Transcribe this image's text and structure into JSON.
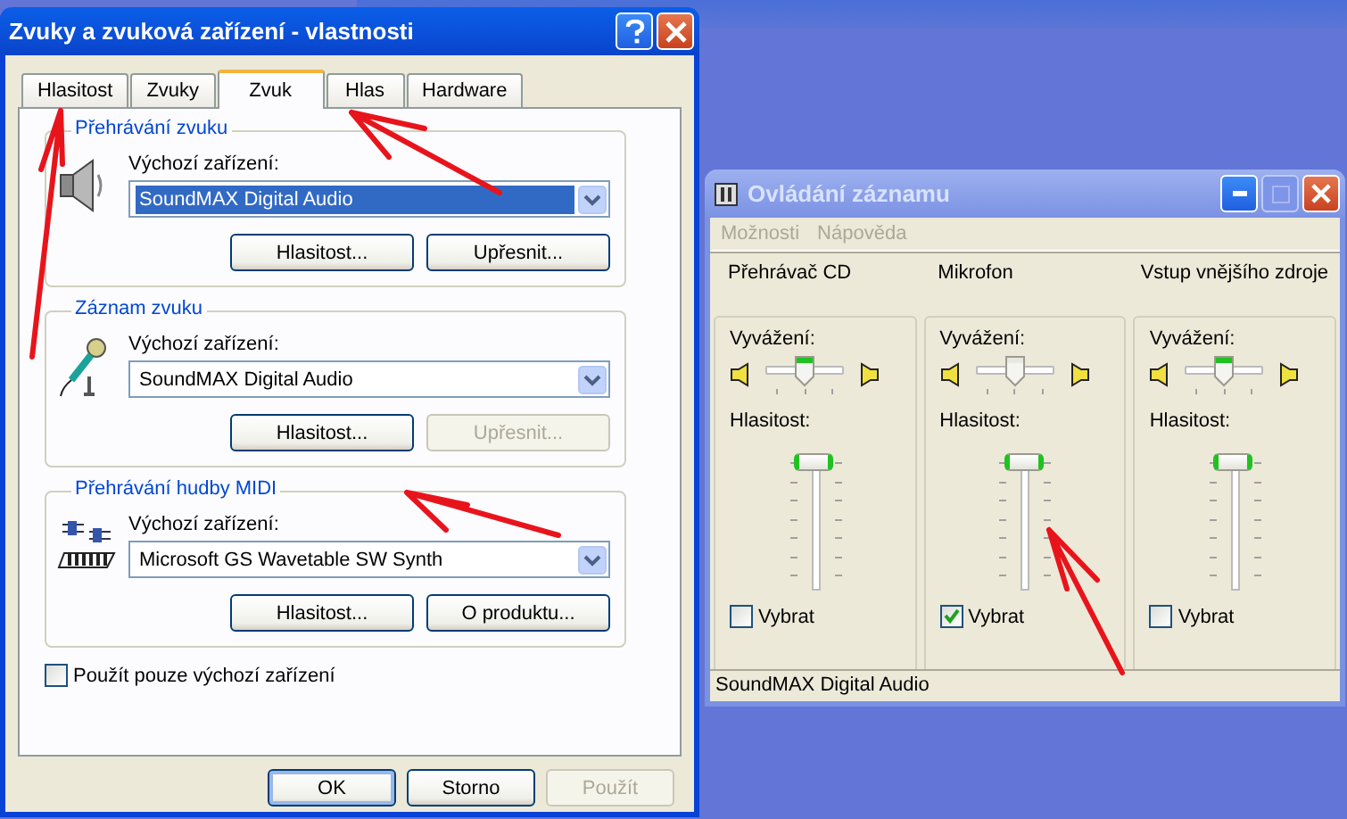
{
  "dialog": {
    "title": "Zvuky a zvuková zařízení - vlastnosti",
    "tabs": [
      {
        "label": "Hlasitost",
        "selected": false
      },
      {
        "label": "Zvuky",
        "selected": false
      },
      {
        "label": "Zvuk",
        "selected": true
      },
      {
        "label": "Hlas",
        "selected": false
      },
      {
        "label": "Hardware",
        "selected": false
      }
    ],
    "groups": [
      {
        "kind": "speaker",
        "legend": "Přehrávání zvuku",
        "field_label": "Výchozí zařízení:",
        "device": "SoundMAX Digital Audio",
        "focused": true,
        "buttons": [
          {
            "label": "Hlasitost...",
            "disabled": false
          },
          {
            "label": "Upřesnit...",
            "disabled": false
          }
        ]
      },
      {
        "kind": "microphone",
        "legend": "Záznam zvuku",
        "field_label": "Výchozí zařízení:",
        "device": "SoundMAX Digital Audio",
        "focused": false,
        "buttons": [
          {
            "label": "Hlasitost...",
            "disabled": false
          },
          {
            "label": "Upřesnit...",
            "disabled": true
          }
        ]
      },
      {
        "kind": "midi",
        "legend": "Přehrávání hudby MIDI",
        "field_label": "Výchozí zařízení:",
        "device": "Microsoft GS Wavetable SW Synth",
        "focused": false,
        "buttons": [
          {
            "label": "Hlasitost...",
            "disabled": false
          },
          {
            "label": "O produktu...",
            "disabled": false
          }
        ]
      }
    ],
    "checkbox": {
      "label": "Použít pouze výchozí zařízení",
      "checked": false
    },
    "buttons": [
      {
        "label": "OK",
        "default": true,
        "disabled": false
      },
      {
        "label": "Storno",
        "default": false,
        "disabled": false
      },
      {
        "label": "Použít",
        "default": false,
        "disabled": true
      }
    ]
  },
  "recording_control": {
    "title": "Ovládání záznamu",
    "menu": [
      "Možnosti",
      "Nápověda"
    ],
    "channels": [
      {
        "name": "Přehrávač CD",
        "balance_label": "Vyvážení:",
        "balance_disabled": false,
        "volume_label": "Hlasitost:",
        "checkbox_label": "Vybrat",
        "checked": false,
        "balance": {
          "level": 0.5
        },
        "volume": {
          "level": 1
        }
      },
      {
        "name": "Mikrofon",
        "balance_label": "Vyvážení:",
        "balance_disabled": true,
        "volume_label": "Hlasitost:",
        "checkbox_label": "Vybrat",
        "checked": true,
        "balance": {
          "level": 0.5
        },
        "volume": {
          "level": 1
        }
      },
      {
        "name": "Vstup vnějšího zdroje",
        "balance_label": "Vyvážení:",
        "balance_disabled": false,
        "volume_label": "Hlasitost:",
        "checkbox_label": "Vybrat",
        "checked": false,
        "balance": {
          "level": 0.5
        },
        "volume": {
          "level": 1
        }
      }
    ],
    "status_bar": "SoundMAX Digital Audio"
  }
}
